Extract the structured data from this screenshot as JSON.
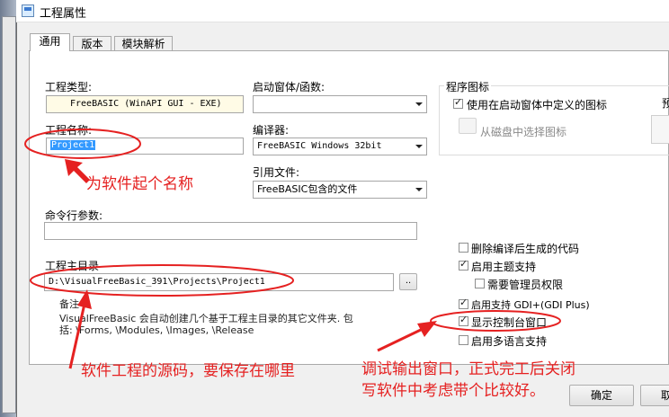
{
  "window": {
    "title": "工程属性"
  },
  "tabs": [
    {
      "label": "通用"
    },
    {
      "label": "版本"
    },
    {
      "label": "模块解析"
    }
  ],
  "form": {
    "project_type_label": "工程类型:",
    "project_type_value": "FreeBASIC (WinAPI GUI - EXE)",
    "project_name_label": "工程名称:",
    "project_name_value": "Project1",
    "startup_label": "启动窗体/函数:",
    "startup_value": "",
    "compiler_label": "编译器:",
    "compiler_value": "FreeBASIC Windows 32bit",
    "include_label": "引用文件:",
    "include_value": "FreeBASIC包含的文件",
    "cmdline_label": "命令行参数:",
    "cmdline_value": "",
    "maindir_label": "工程主目录",
    "maindir_value": "D:\\VisualFreeBasic_391\\Projects\\Project1",
    "browse_label": "..",
    "note_title": "备注",
    "note_line1": "VisualFreeBasic 会自动创建几个基于工程主目录的其它文件夹. 包",
    "note_line2": "括: \\Forms, \\Modules, \\Images, \\Release"
  },
  "icon_group": {
    "title": "程序图标",
    "use_startup_icon": {
      "label": "使用在启动窗体中定义的图标",
      "checked": true
    },
    "pick_disk_label": "从磁盘中选择图标",
    "preview_label": "预"
  },
  "options": [
    {
      "label": "删除编译后生成的代码",
      "checked": false
    },
    {
      "label": "启用主题支持",
      "checked": true
    },
    {
      "label": "需要管理员权限",
      "checked": false
    },
    {
      "label": "启用支持 GDI+(GDI Plus)",
      "checked": true
    },
    {
      "label": "显示控制台窗口",
      "checked": true
    },
    {
      "label": "启用多语言支持",
      "checked": false
    }
  ],
  "buttons": {
    "ok": "确定",
    "cancel": "取"
  },
  "annotations": {
    "name": "为软件起个名称",
    "source": "软件工程的源码，要保存在哪里",
    "console_line1": "调试输出窗口，正式完工后关闭",
    "console_line2": "写软件中考虑带个比较好。"
  },
  "colors": {
    "annotation": "#e52121",
    "selection": "#3399ff"
  }
}
